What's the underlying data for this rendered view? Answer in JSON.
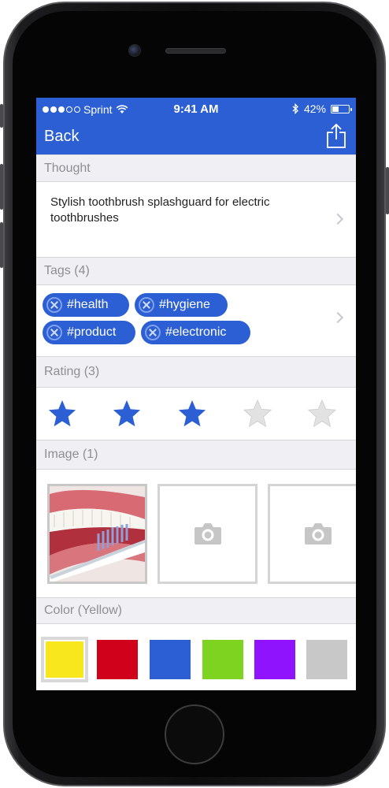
{
  "status_bar": {
    "carrier": "Sprint",
    "time": "9:41 AM",
    "battery_percent": "42%",
    "battery_level": 0.42
  },
  "nav": {
    "back_label": "Back",
    "share_icon": "share-icon"
  },
  "sections": {
    "thought": {
      "header": "Thought",
      "text": "Stylish toothbrush splashguard for electric toothbrushes"
    },
    "tags": {
      "header": "Tags (4)",
      "items": [
        "#health",
        "#hygiene",
        "#product",
        "#electronic"
      ]
    },
    "rating": {
      "header": "Rating (3)",
      "value": 3,
      "max": 5
    },
    "image": {
      "header": "Image (1)",
      "slots": [
        "photo",
        "empty",
        "empty"
      ]
    },
    "color": {
      "header": "Color (Yellow)",
      "swatches": [
        "#f8e71c",
        "#d0021b",
        "#2c5fd3",
        "#7ed321",
        "#9013fe",
        "#c8c8c8"
      ],
      "selected_index": 0
    }
  },
  "colors": {
    "accent": "#2c5fd3",
    "star_empty": "#d4d4d4"
  }
}
